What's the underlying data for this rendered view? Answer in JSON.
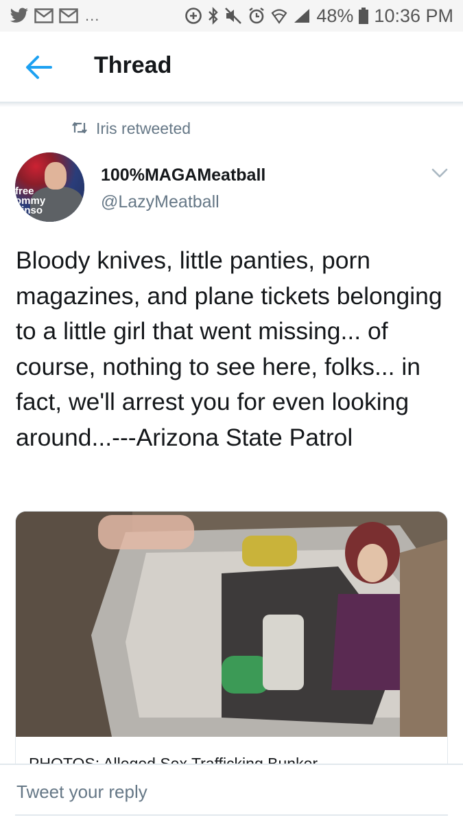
{
  "status_bar": {
    "battery": "48%",
    "time": "10:36 PM",
    "notification_overflow": "..."
  },
  "header": {
    "title": "Thread"
  },
  "retweet": {
    "label": "Iris retweeted"
  },
  "tweet": {
    "author_name": "100%MAGAMeatball",
    "author_handle": "@LazyMeatball",
    "avatar_caption": "free\nommy\nbinso",
    "text": "Bloody knives, little panties, porn magazines, and plane tickets belonging to a little girl that went missing... of course, nothing to see here, folks... in fact, we'll arrest you for even looking around...---Arizona State Patrol"
  },
  "card": {
    "title": "PHOTOS: Alleged Sex Trafficking Bunker"
  },
  "reply": {
    "placeholder": "Tweet your reply"
  },
  "colors": {
    "accent": "#1da1f2",
    "secondary_text": "#657786",
    "primary_text": "#14171a",
    "divider": "#e1e8ed"
  },
  "icons": {
    "status_left": [
      "twitter-icon",
      "gmail-icon",
      "gmail-icon"
    ],
    "status_right": [
      "data-saver-icon",
      "bluetooth-icon",
      "mute-icon",
      "alarm-icon",
      "wifi-icon",
      "signal-icon",
      "battery-icon"
    ],
    "header": "back-arrow-icon",
    "retweet": "retweet-icon",
    "tweet_menu": "chevron-down-icon"
  }
}
